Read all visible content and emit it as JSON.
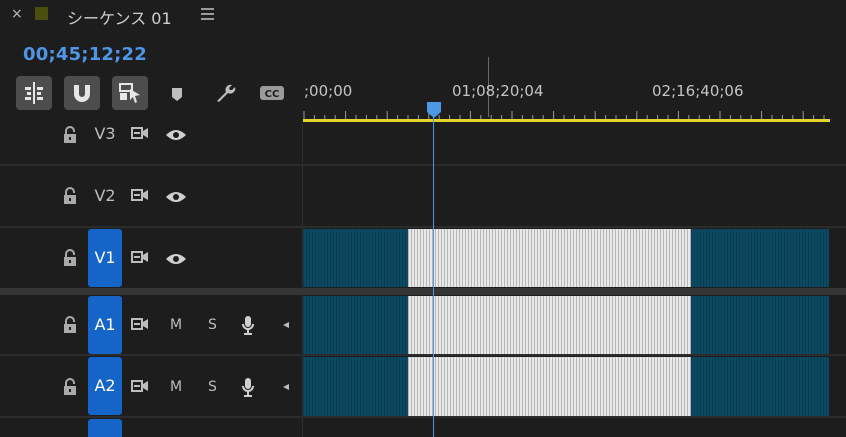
{
  "header": {
    "close": "×",
    "sequence_name": "シーケンス 01",
    "swatch_color": "#4a4f10"
  },
  "timecode": "00;45;12;22",
  "toolbar": {
    "buttons": [
      "insert-as-nest-icon",
      "snap-magnet-icon",
      "linked-selection-icon",
      "add-marker-icon",
      "settings-wrench-icon",
      "captions-icon"
    ]
  },
  "ruler": {
    "labels": [
      ";00;00",
      "01;08;20;04",
      "02;16;40;06"
    ],
    "accent": "#e3d52a"
  },
  "tracks": {
    "v3": {
      "label": "V3"
    },
    "v2": {
      "label": "V2"
    },
    "v1": {
      "label": "V1"
    },
    "a1": {
      "label": "A1",
      "mute": "M",
      "solo": "S"
    },
    "a2": {
      "label": "A2",
      "mute": "M",
      "solo": "S"
    }
  },
  "colors": {
    "playhead": "#4e96e6",
    "track_target": "#1565c9",
    "clip_teal": "#0c4a63",
    "clip_white": "#e9e9e9"
  }
}
